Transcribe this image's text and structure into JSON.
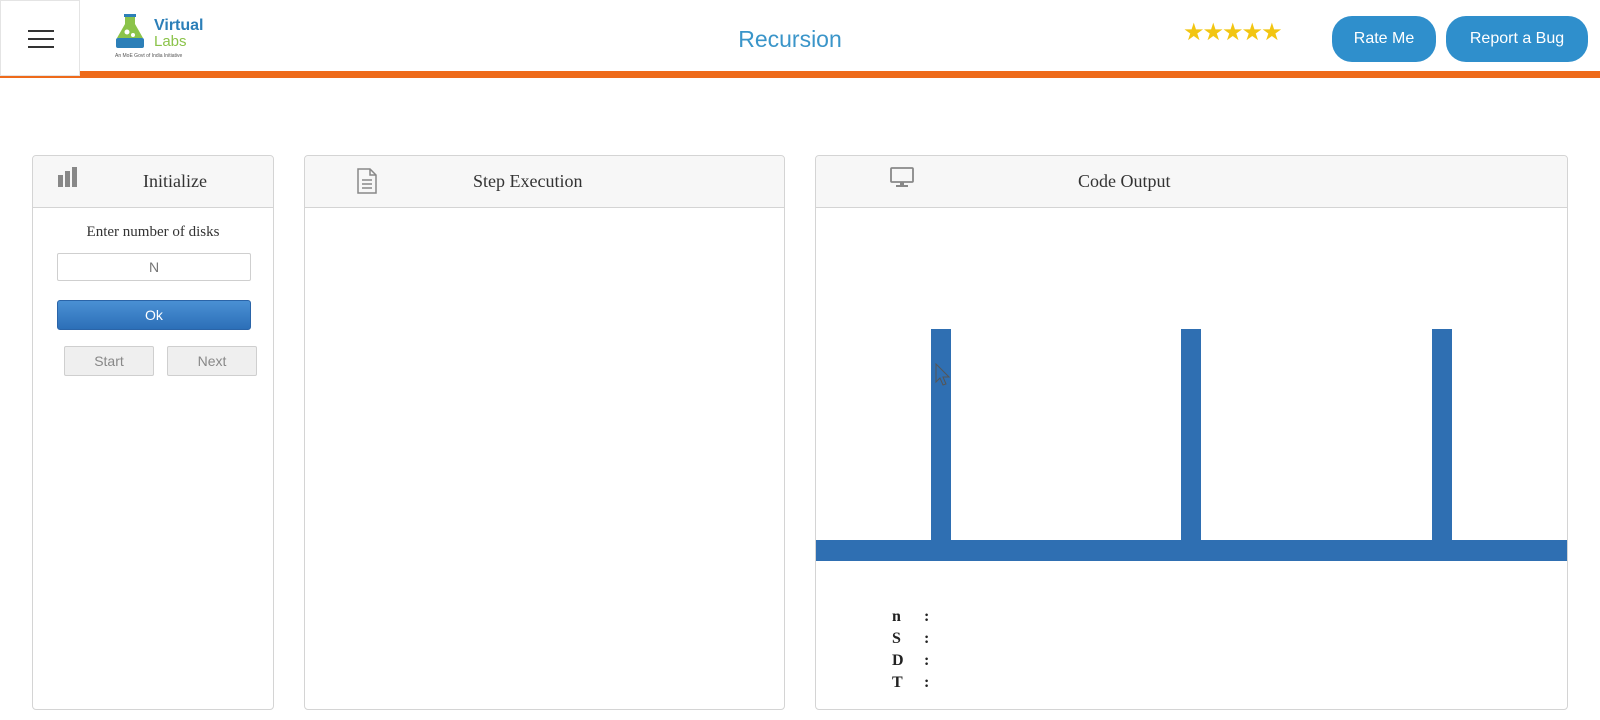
{
  "header": {
    "menu_icon": "hamburger-icon",
    "logo": {
      "line1": "Virtual",
      "line2": "Labs",
      "tagline": "An MoE Govt of India Initiative"
    },
    "title": "Recursion",
    "rating_stars": 5,
    "rating_display": "★★★★★",
    "rate_button": "Rate Me",
    "bug_button": "Report a Bug",
    "accent_color": "#ee6a1a",
    "brand_color": "#2f8fcc"
  },
  "panels": {
    "initialize": {
      "title": "Initialize",
      "icon": "bar-chart-icon",
      "label": "Enter number of disks",
      "input_placeholder": "N",
      "ok_button": "Ok",
      "start_button": "Start",
      "next_button": "Next"
    },
    "step": {
      "title": "Step Execution",
      "icon": "document-icon"
    },
    "output": {
      "title": "Code Output",
      "icon": "monitor-icon",
      "peg_color": "#2f6fb2",
      "variables": [
        {
          "name": "n",
          "value": ""
        },
        {
          "name": "S",
          "value": ""
        },
        {
          "name": "D",
          "value": ""
        },
        {
          "name": "T",
          "value": ""
        }
      ]
    }
  }
}
